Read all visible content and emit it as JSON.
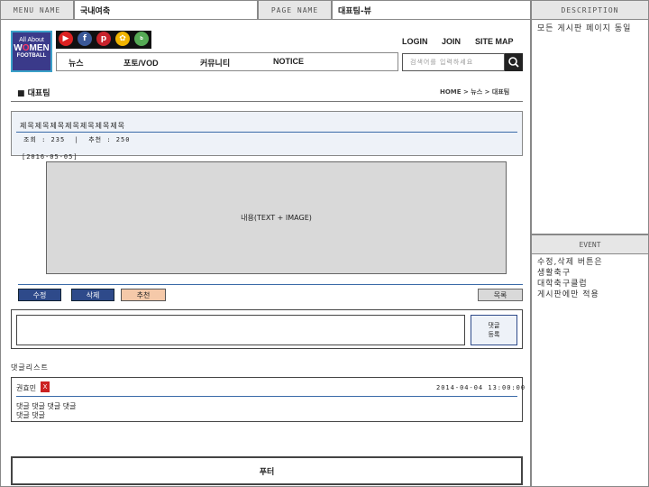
{
  "header": {
    "menu_name_label": "MENU NAME",
    "menu_name_value": "국내여축",
    "page_name_label": "PAGE NAME",
    "page_name_value": "대표팀-뷰",
    "description_label": "DESCRIPTION"
  },
  "logo": {
    "line1": "All About",
    "line2": "W",
    "line2b": "MEN",
    "line3": "FOOTBALL"
  },
  "social_icons": [
    "youtube-icon",
    "facebook-icon",
    "pinterest-icon",
    "kakaostory-icon",
    "band-icon"
  ],
  "topnav": {
    "login": "LOGIN",
    "join": "JOIN",
    "sitemap": "SITE MAP"
  },
  "menu": {
    "items": [
      "뉴스",
      "포토/VOD",
      "커뮤니티",
      "NOTICE"
    ]
  },
  "search": {
    "placeholder": "검색어를 입력하세요"
  },
  "section": {
    "title": "■ 대표팀",
    "breadcrumb": "HOME > 뉴스 > 대표팀"
  },
  "post": {
    "title": "제목제목제목제목제목제목제목",
    "meta": "조회 : 235  |  추천 : 250",
    "date": "[2016-05-05]",
    "content": "내용(TEXT + IMAGE)"
  },
  "actions": {
    "edit": "수정",
    "delete": "삭제",
    "recommend": "추천",
    "list": "목록"
  },
  "comment_form": {
    "submit_line1": "댓글",
    "submit_line2": "등록"
  },
  "comments": {
    "title": "댓글리스트",
    "items": [
      {
        "author": "권효민",
        "delete": "X",
        "date": "2014-04-04 13:00:00",
        "line1": "댓글 댓글 댓글 댓글",
        "line2": "댓글 댓글"
      }
    ]
  },
  "footer": {
    "label": "푸터"
  },
  "description": {
    "text": "모든 게시판 페이지 동일",
    "event_label": "EVENT",
    "event_lines": [
      "수정,삭제 버튼은",
      "생활축구",
      "대학축구클럽",
      "게시판에만 적용"
    ]
  },
  "colors": {
    "edit": "#2e4a8a",
    "delete": "#2e4a8a",
    "recommend": "#f5c9a9",
    "list": "#d9d9d9",
    "accent": "#3a6aa8"
  }
}
